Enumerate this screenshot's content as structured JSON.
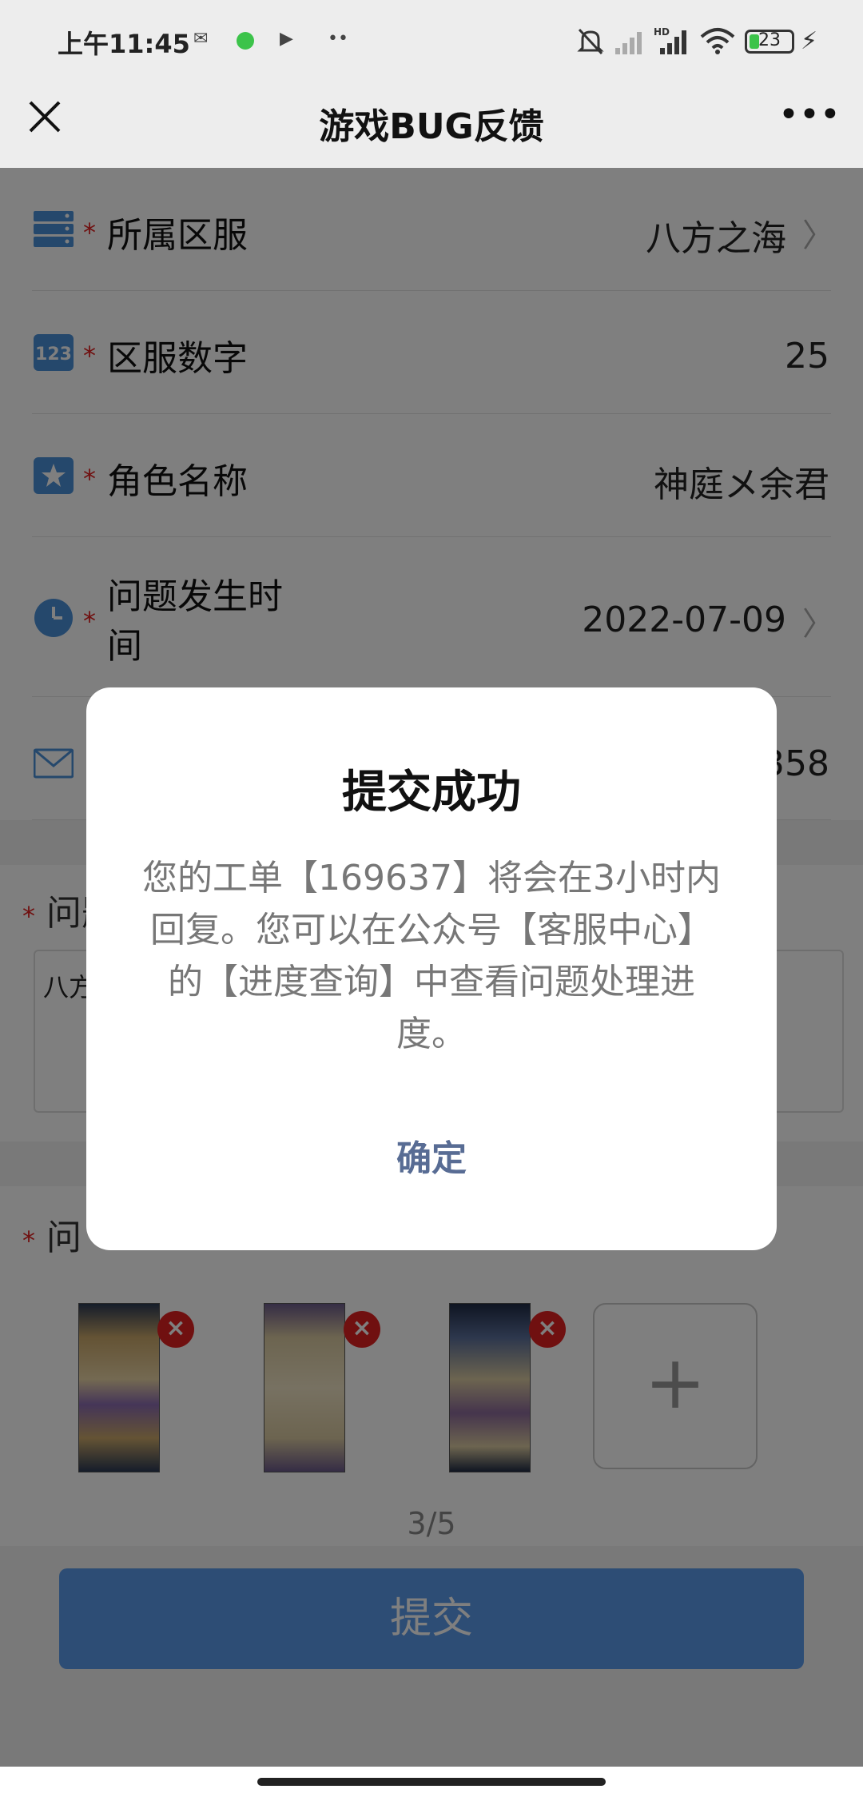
{
  "status_bar": {
    "time": "上午11:45",
    "battery": "23",
    "battery_level": 0.23,
    "icons": [
      "message-icon",
      "app-icon",
      "video-icon",
      "more-dots-icon",
      "mute-icon",
      "signal-icon",
      "hd-signal-icon",
      "wifi-icon",
      "battery-icon",
      "charging-icon"
    ]
  },
  "header": {
    "title": "游戏BUG反馈",
    "close_icon": "close-icon",
    "more_label": "•••"
  },
  "form": {
    "rows": [
      {
        "icon": "server-icon",
        "label": "所属区服",
        "value": "八方之海",
        "chevron": true
      },
      {
        "icon": "number-123-icon",
        "label": "区服数字",
        "value": "25",
        "chevron": false
      },
      {
        "icon": "star-icon",
        "label": "角色名称",
        "value": "神庭メ余君",
        "chevron": false
      },
      {
        "icon": "clock-icon",
        "label": "问题发生时间",
        "value": "2022-07-09",
        "chevron": true
      },
      {
        "icon": "mail-icon",
        "label": "",
        "value": "358",
        "chevron": false
      }
    ],
    "required_mark": "*",
    "description_label": "问题",
    "description_text": "八方",
    "screenshots_label": "问",
    "screenshot_count": "3/5",
    "add_label": "+",
    "delete_label": "×",
    "submit_label": "提交"
  },
  "dialog": {
    "title": "提交成功",
    "body": "您的工单【169637】将会在3小时内回复。您可以在公众号【客服中心】的【进度查询】中查看问题处理进度。",
    "ok_label": "确定"
  },
  "colors": {
    "accent": "#586c94",
    "required": "#e02020",
    "submit": "#5b9bea",
    "icon_blue": "#4a90d9"
  }
}
